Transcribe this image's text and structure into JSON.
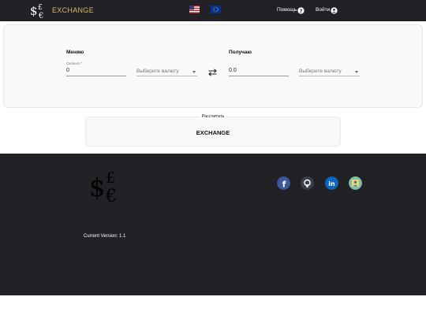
{
  "header": {
    "brand": "EXCHANGE",
    "logo_icon": "currency-symbols-icon",
    "languages": [
      "flag-us-icon",
      "flag-eu-icon"
    ],
    "help_label": "Помощь",
    "login_label": "Войти"
  },
  "converter": {
    "give": {
      "title": "Меняю",
      "amount_label": "Сколько *",
      "amount_value": "0",
      "currency_placeholder": "Выберите валюту"
    },
    "get": {
      "title": "Получаю",
      "amount_value": "0.0",
      "currency_placeholder": "Выберите валюту"
    },
    "swap_icon": "swap-arrows-icon"
  },
  "calculate": {
    "label": "Рассчитать",
    "button_label": "EXCHANGE"
  },
  "footer": {
    "version_text": "Current Version: 1.1",
    "social": [
      "facebook-icon",
      "github-icon",
      "linkedin-icon",
      "profile-icon"
    ]
  },
  "colors": {
    "topbar": "#222126",
    "brand": "#d7b86a",
    "footer": "#222126",
    "facebook": "#3b5998",
    "github": "#24292e",
    "linkedin": "#0a66c2",
    "profile": "#7cc0a8"
  }
}
